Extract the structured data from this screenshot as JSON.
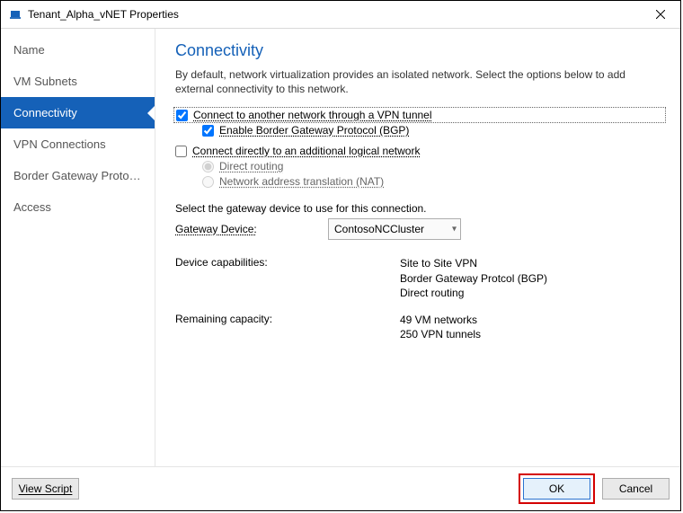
{
  "window": {
    "title": "Tenant_Alpha_vNET Properties"
  },
  "sidebar": {
    "items": [
      {
        "label": "Name"
      },
      {
        "label": "VM Subnets"
      },
      {
        "label": "Connectivity"
      },
      {
        "label": "VPN Connections"
      },
      {
        "label": "Border Gateway Protocol..."
      },
      {
        "label": "Access"
      }
    ],
    "activeIndex": 2
  },
  "page": {
    "title": "Connectivity",
    "description": "By default, network virtualization provides an isolated network. Select the options below to add external connectivity to this network.",
    "vpn_tunnel_label": "Connect to another network through a VPN tunnel",
    "bgp_label": "Enable Border Gateway Protocol (BGP)",
    "direct_connect_label": "Connect directly to an additional logical network",
    "direct_routing_label": "Direct routing",
    "nat_label": "Network address translation (NAT)",
    "gateway_prompt": "Select the gateway device to use for this connection.",
    "gateway_label": "Gateway Device:",
    "gateway_value": "ContosoNCCluster",
    "caps_label": "Device capabilities:",
    "caps_values": [
      "Site to Site VPN",
      "Border Gateway Protcol (BGP)",
      "Direct routing"
    ],
    "remaining_label": "Remaining capacity:",
    "remaining_values": [
      "49 VM networks",
      "250 VPN tunnels"
    ]
  },
  "footer": {
    "view_script": "View Script",
    "ok": "OK",
    "cancel": "Cancel"
  }
}
